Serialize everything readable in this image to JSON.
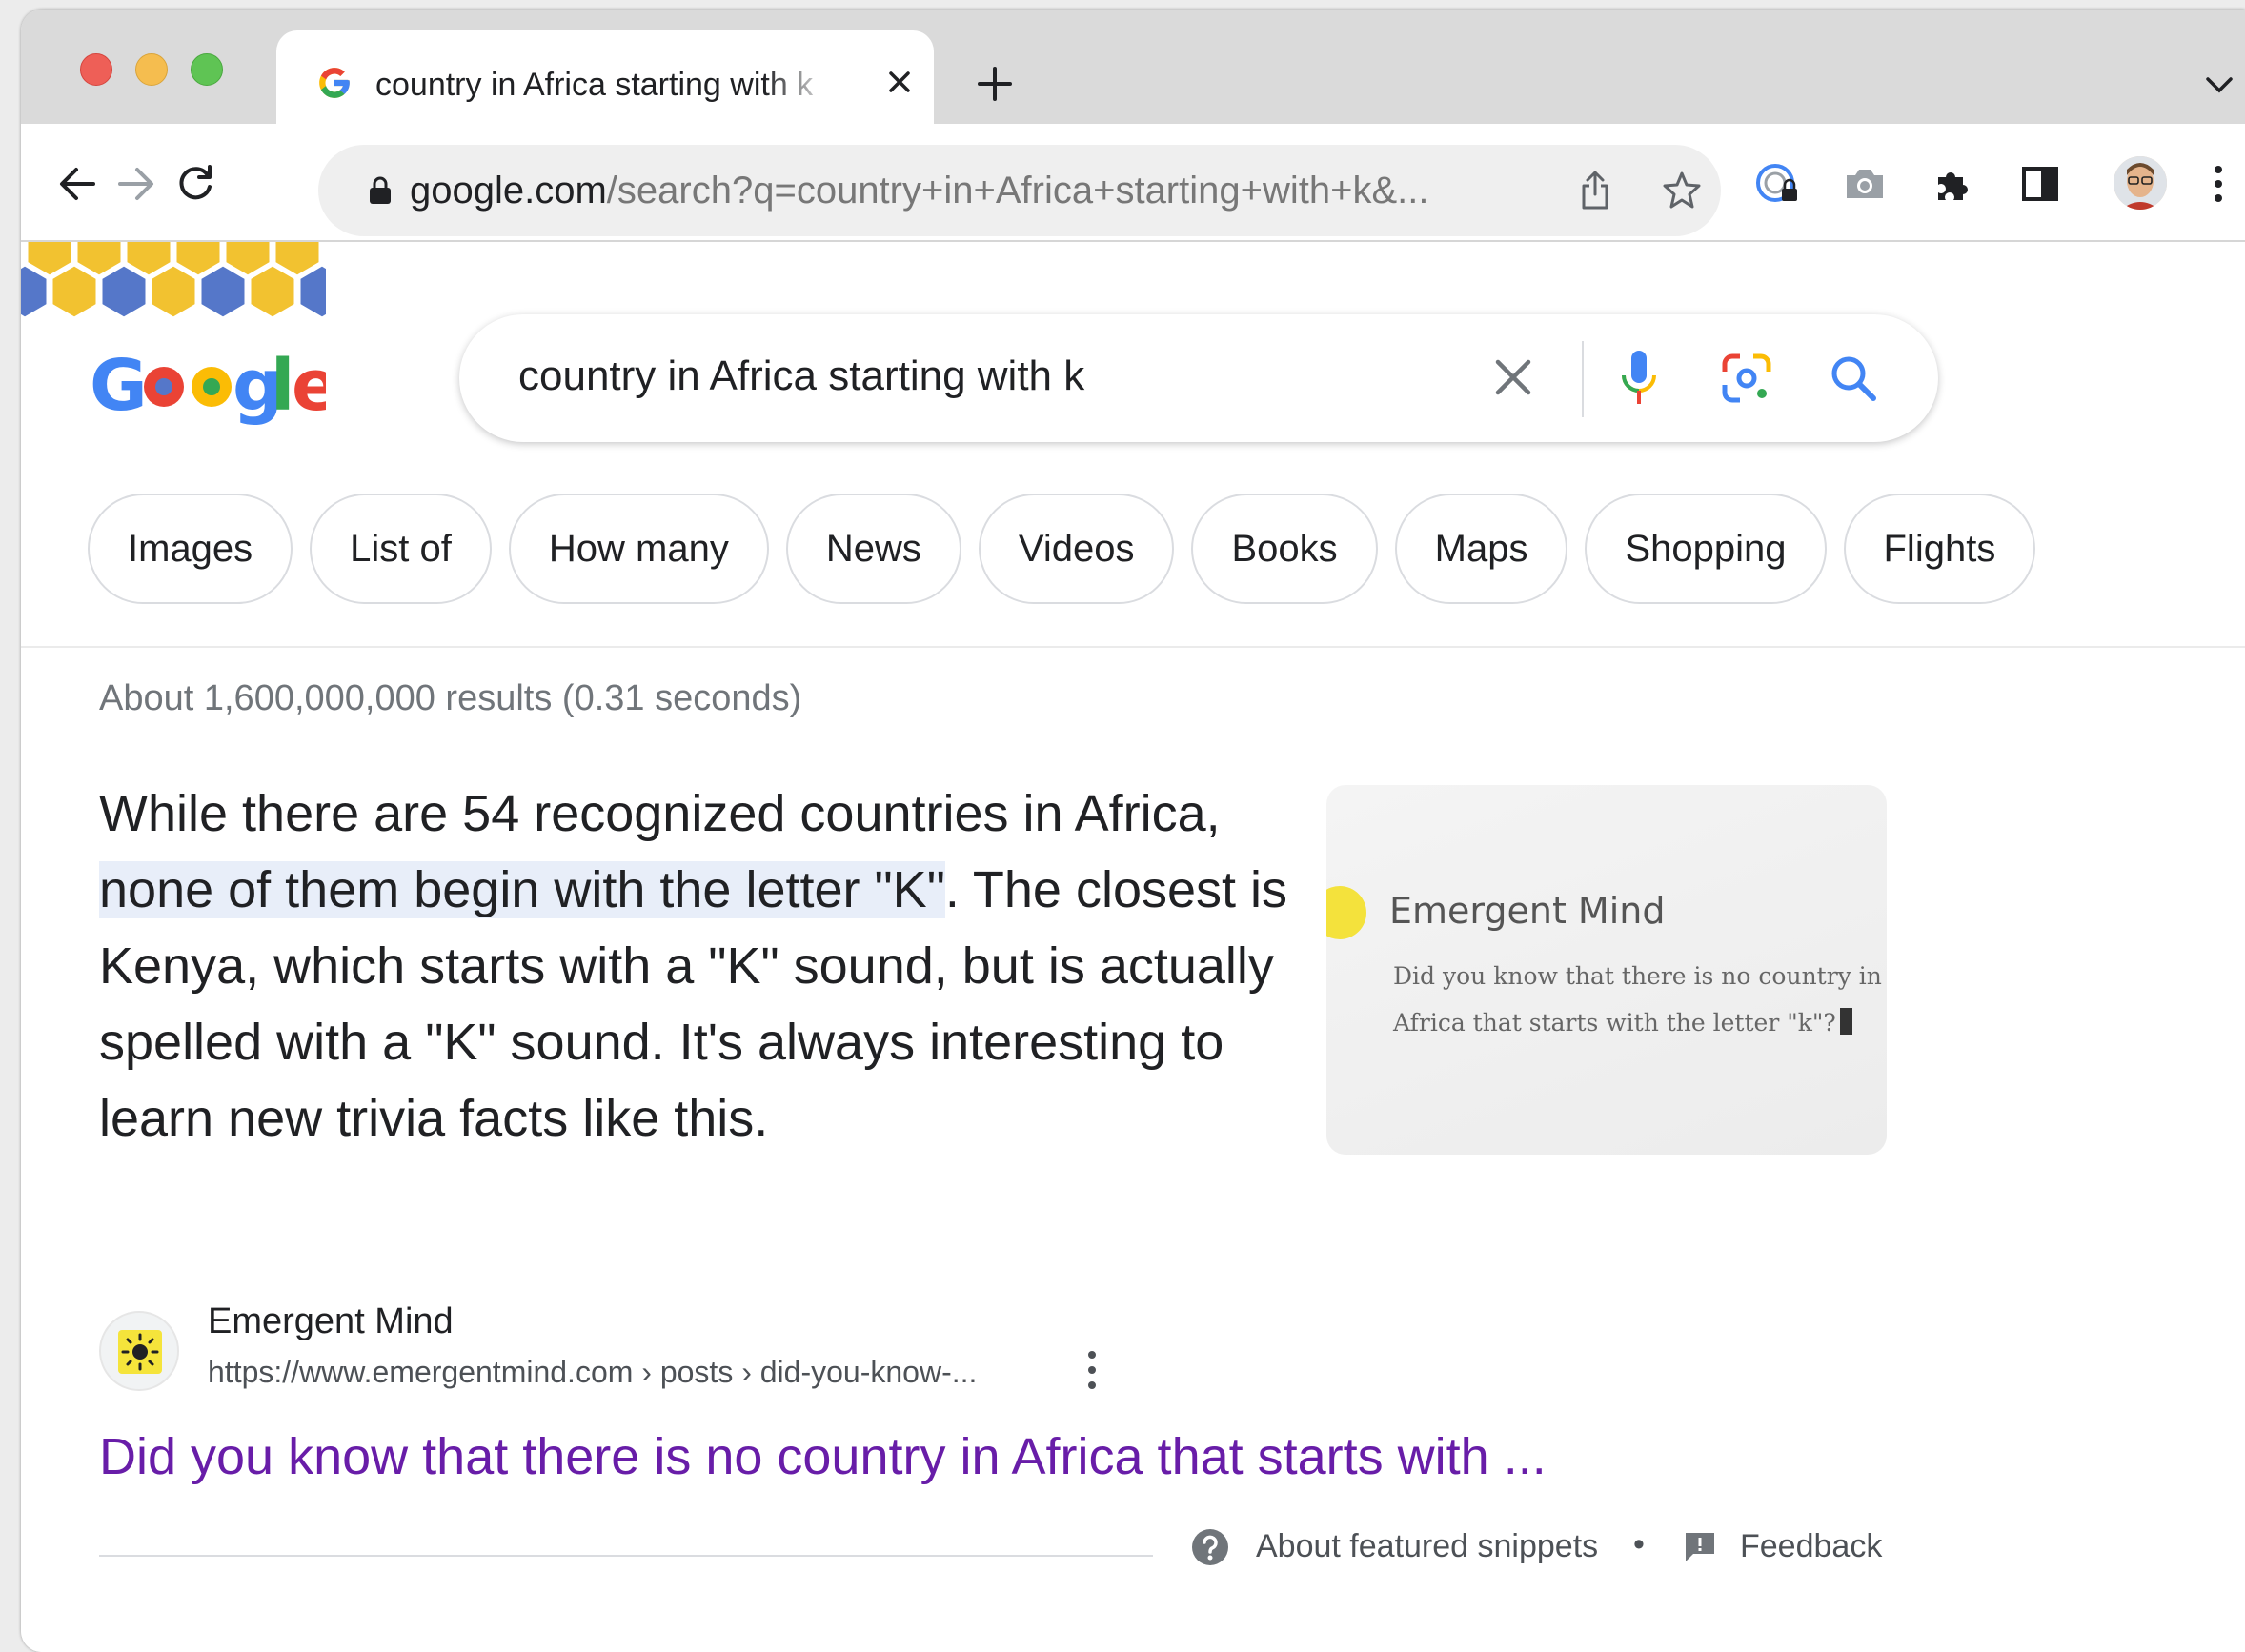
{
  "browser": {
    "tab_title": "country in Africa starting with k",
    "new_tab_symbol": "+",
    "url_host": "google.com",
    "url_path": "/search?q=country+in+Africa+starting+with+k&..."
  },
  "search": {
    "query": "country in Africa starting with k"
  },
  "chips": [
    "Images",
    "List of",
    "How many",
    "News",
    "Videos",
    "Books",
    "Maps",
    "Shopping",
    "Flights"
  ],
  "results": {
    "stats": "About 1,600,000,000 results (0.31 seconds)"
  },
  "snippet": {
    "before": "While there are 54 recognized countries in Africa, ",
    "highlight": "none of them begin with the letter \"K\"",
    "after": ". The closest is Kenya, which starts with a \"K\" sound, but is actually spelled with a \"K\" sound. It's always interesting to learn new trivia facts like this."
  },
  "thumbnail": {
    "title": "Emergent Mind",
    "line1": "Did you know that there is no country in",
    "line2": "Africa that starts with the letter \"k\"?"
  },
  "source": {
    "name": "Emergent Mind",
    "url": "https://www.emergentmind.com › posts › did-you-know-...",
    "link_title": "Did you know that there is no country in Africa that starts with ..."
  },
  "footer": {
    "about": "About featured snippets",
    "separator": "•",
    "feedback": "Feedback"
  },
  "colors": {
    "link_visited": "#681da8",
    "highlight": "#e8eef9",
    "google_blue": "#4285f4",
    "google_red": "#ea4335",
    "google_yellow": "#fbbc05",
    "google_green": "#34a853"
  }
}
